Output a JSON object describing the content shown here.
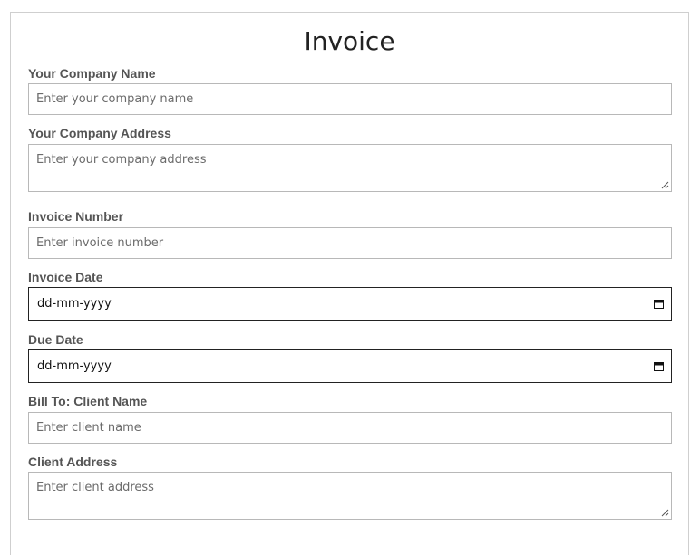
{
  "form": {
    "title": "Invoice",
    "fields": {
      "company_name": {
        "label": "Your Company Name",
        "placeholder": "Enter your company name"
      },
      "company_address": {
        "label": "Your Company Address",
        "placeholder": "Enter your company address"
      },
      "invoice_number": {
        "label": "Invoice Number",
        "placeholder": "Enter invoice number"
      },
      "invoice_date": {
        "label": "Invoice Date",
        "value": "dd-mm-yyyy"
      },
      "due_date": {
        "label": "Due Date",
        "value": "dd-mm-yyyy"
      },
      "client_name": {
        "label": "Bill To: Client Name",
        "placeholder": "Enter client name"
      },
      "client_address": {
        "label": "Client Address",
        "placeholder": "Enter client address"
      }
    }
  },
  "icons": {
    "date_picker": "calendar-icon",
    "resize_grip": "resize-grip-icon"
  },
  "colors": {
    "label": "#555555",
    "border": "#b8b8b8",
    "title": "#222222"
  }
}
